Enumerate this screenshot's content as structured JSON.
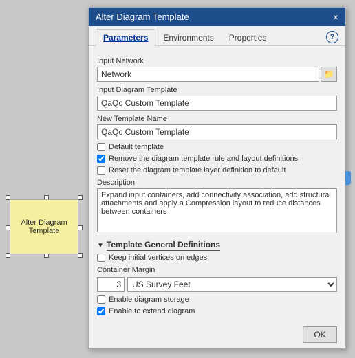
{
  "dialog": {
    "title": "Alter Diagram Template",
    "close_label": "×",
    "tabs": [
      {
        "id": "parameters",
        "label": "Parameters",
        "active": true
      },
      {
        "id": "environments",
        "label": "Environments",
        "active": false
      },
      {
        "id": "properties",
        "label": "Properties",
        "active": false
      }
    ],
    "help_label": "?",
    "fields": {
      "input_network_label": "Input Network",
      "input_network_value": "Network",
      "input_diagram_template_label": "Input Diagram Template",
      "input_diagram_template_value": "QaQc Custom Template",
      "new_template_name_label": "New Template Name",
      "new_template_name_value": "QaQc Custom Template",
      "default_template_label": "Default template",
      "default_template_checked": false,
      "remove_rule_label": "Remove the diagram template rule and layout definitions",
      "remove_rule_checked": true,
      "reset_layer_label": "Reset the diagram template layer definition to default",
      "reset_layer_checked": false,
      "description_label": "Description",
      "description_value": "Expand input containers, add connectivity association, add structural attachments and apply a Compression layout to reduce distances between containers"
    },
    "section": {
      "title": "Template General Definitions",
      "arrow": "▼",
      "keep_vertices_label": "Keep initial vertices on edges",
      "keep_vertices_checked": false,
      "container_margin_label": "Container Margin",
      "container_margin_value": "3",
      "container_margin_unit": "US Survey Feet",
      "enable_storage_label": "Enable diagram storage",
      "enable_storage_checked": false,
      "enable_extend_label": "Enable to extend diagram",
      "enable_extend_checked": true
    },
    "ok_label": "OK"
  },
  "node": {
    "label": "Alter Diagram\nTemplate"
  }
}
